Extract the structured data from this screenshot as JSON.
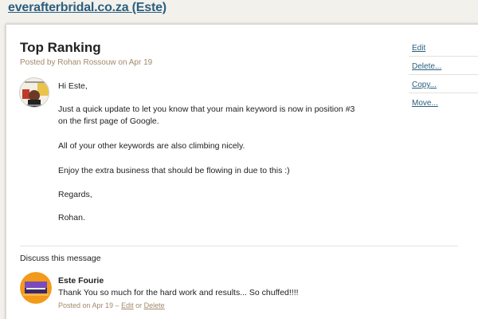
{
  "header": {
    "project_link": "everafterbridal.co.za (Este)"
  },
  "message": {
    "title": "Top Ranking",
    "meta": "Posted by Rohan Rossouw on Apr 19",
    "body": {
      "greeting": "Hi Este,",
      "line1": "Just a quick update to let you know that your main keyword is now in position #3",
      "line2": "on the first page of Google.",
      "line3": "All of your other keywords are also climbing nicely.",
      "line4": "Enjoy the extra business that should be flowing in due to this :)",
      "line5": "Regards,",
      "signature": "Rohan."
    }
  },
  "actions": {
    "edit": "Edit",
    "delete": "Delete...",
    "copy": "Copy...",
    "move": "Move..."
  },
  "discussion": {
    "label": "Discuss this message",
    "comment": {
      "author": "Este Fourie",
      "text": "Thank You so much for the hard work and results... So chuffed!!!!",
      "meta_prefix": "Posted on Apr 19 –",
      "edit_label": "Edit",
      "or_label": "or",
      "delete_label": "Delete"
    }
  },
  "colors": {
    "link": "#2b5f7f",
    "meta": "#a08a6a",
    "background": "#f3f1ec",
    "avatar_orange": "#f29a1a"
  },
  "icons": {
    "author_avatar": "author-avatar-photo",
    "commenter_avatar": "commenter-avatar-photo"
  }
}
